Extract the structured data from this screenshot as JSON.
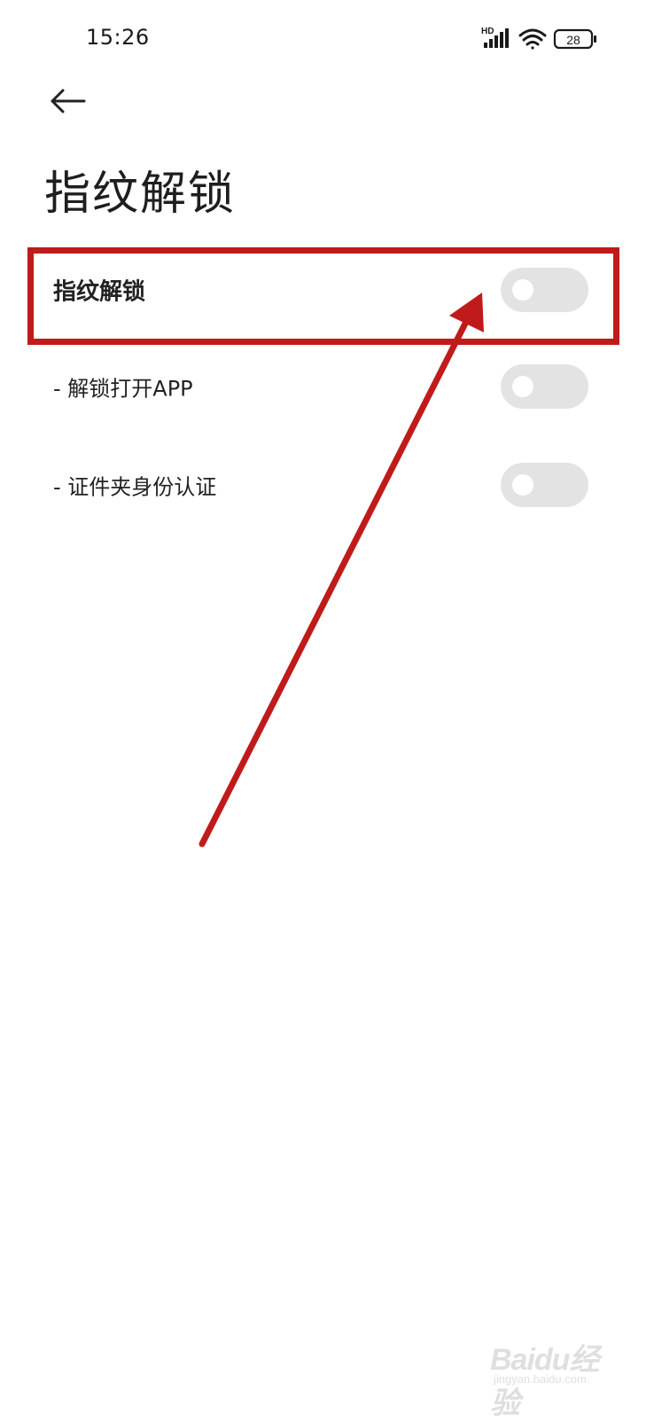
{
  "status_bar": {
    "time": "15:26",
    "network_badge": "HD",
    "battery_level": "28",
    "icons": [
      "signal-icon",
      "wifi-icon",
      "battery-icon"
    ]
  },
  "header": {
    "back_icon": "back-arrow-icon",
    "title": "指纹解锁"
  },
  "settings": [
    {
      "label": "指纹解锁",
      "enabled": false
    },
    {
      "label": "- 解锁打开APP",
      "enabled": false
    },
    {
      "label": "- 证件夹身份认证",
      "enabled": false
    }
  ],
  "annotation": {
    "highlight_color": "#c01b1b",
    "arrow_color": "#c01b1b"
  },
  "watermark": {
    "brand": "Baidu经验",
    "sub": "jingyan.baidu.com"
  },
  "colors": {
    "background": "#ffffff",
    "toggle_off": "#e3e3e3",
    "text_primary": "#222222"
  }
}
